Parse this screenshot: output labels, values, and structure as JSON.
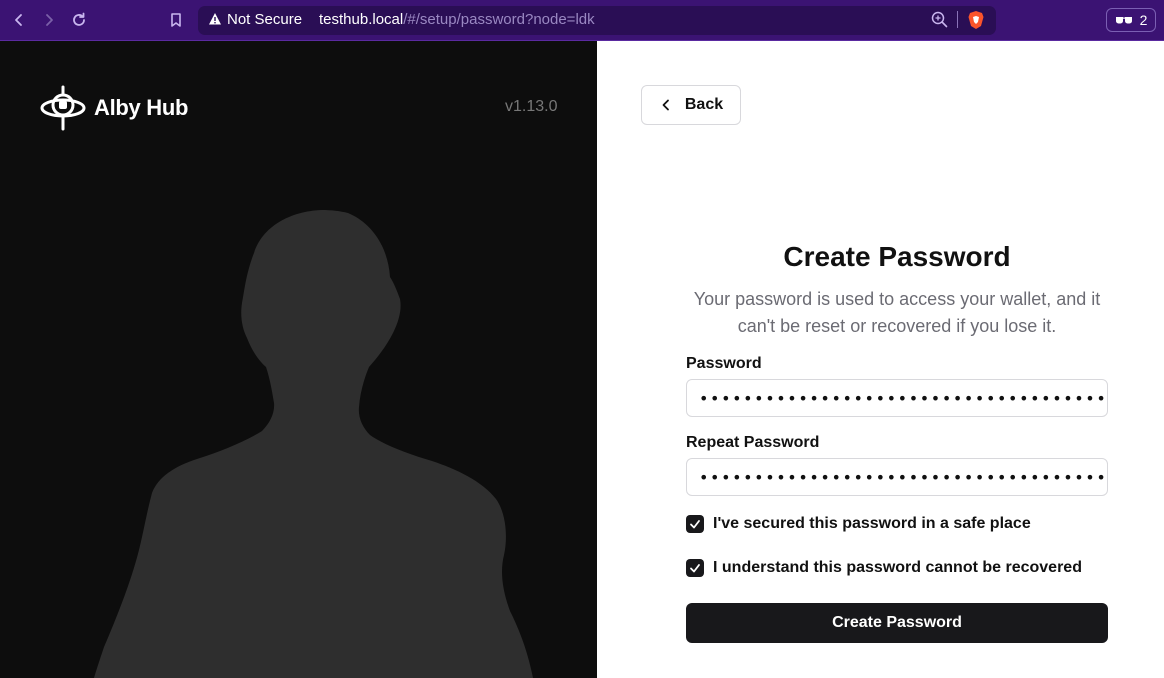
{
  "browser": {
    "security_label": "Not Secure",
    "url_host": "testhub.local",
    "url_path": "/#/setup/password?node=ldk",
    "extension_count": "2"
  },
  "brand": {
    "name": "Alby Hub",
    "version": "v1.13.0"
  },
  "nav": {
    "back_label": "Back"
  },
  "form": {
    "title": "Create Password",
    "subtitle": "Your password is used to access your wallet, and it can't be reset or recovered if you lose it.",
    "password_label": "Password",
    "password_value": "••••••••••••••••••••••••••••••••••••••••••••••••••",
    "repeat_label": "Repeat Password",
    "repeat_value": "••••••••••••••••••••••••••••••••••••••••••••••••••",
    "check1_label": "I've secured this password in a safe place",
    "check1_checked": true,
    "check2_label": "I understand this password cannot be recovered",
    "check2_checked": true,
    "submit_label": "Create Password"
  },
  "colors": {
    "chrome_bg": "#3b1373",
    "left_bg": "#0d0d0d",
    "primary_button": "#18181b"
  }
}
